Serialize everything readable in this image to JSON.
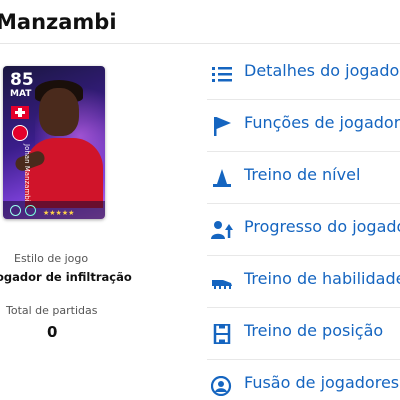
{
  "header": {
    "title": "Manzambi"
  },
  "player_card": {
    "rating": "85",
    "position": "MAT",
    "name": "Johan Manzambi",
    "stars": "★★★★★"
  },
  "stats": {
    "play_style_label": "Estilo de jogo",
    "play_style_value": "ogador de infiltração",
    "matches_label": "Total de partidas",
    "matches_value": "0"
  },
  "menu": [
    {
      "label": "Detalhes do jogado",
      "icon": "list-icon"
    },
    {
      "label": "Funções de jogador",
      "icon": "flag-icon"
    },
    {
      "label": "Treino de nível",
      "icon": "cone-icon"
    },
    {
      "label": "Progresso do jogado",
      "icon": "person-up-icon"
    },
    {
      "label": "Treino de habilidade",
      "icon": "boot-icon"
    },
    {
      "label": "Treino de posição",
      "icon": "pitch-icon"
    },
    {
      "label": "Fusão de jogadores",
      "icon": "person-search-icon"
    }
  ],
  "colors": {
    "accent": "#1565c0"
  }
}
